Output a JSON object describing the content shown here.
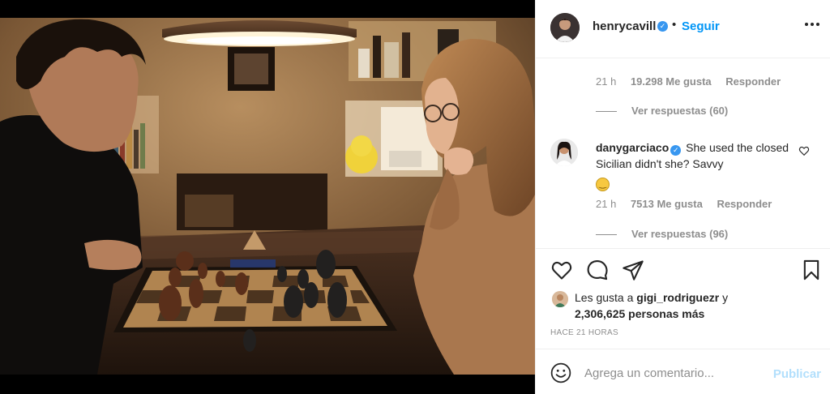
{
  "header": {
    "username": "henrycavill",
    "separator": "•",
    "follow_label": "Seguir",
    "avatar_icon": "profile-avatar",
    "more_icon": "more-options-icon"
  },
  "comments": {
    "previous": {
      "time": "21 h",
      "likes": "19.298 Me gusta",
      "reply_label": "Responder",
      "view_replies": "Ver respuestas (60)"
    },
    "main": {
      "username": "danygarciaco",
      "text": "She used the closed Sicilian didn't she? Savvy",
      "emoji": "smiling-face-emoji",
      "time": "21 h",
      "likes": "7513 Me gusta",
      "reply_label": "Responder",
      "view_replies": "Ver respuestas (96)"
    }
  },
  "likes": {
    "prefix": "Les gusta a",
    "user": "gigi_rodriguezr",
    "conjunction": "y",
    "others": "2,306,625 personas más"
  },
  "time_ago": "HACE 21 HORAS",
  "add_comment": {
    "placeholder": "Agrega un comentario...",
    "publish_label": "Publicar"
  },
  "colors": {
    "accent": "#0095f6",
    "verified": "#3897f0",
    "publish_disabled": "#b2dffc",
    "muted": "#8e8e8e"
  }
}
